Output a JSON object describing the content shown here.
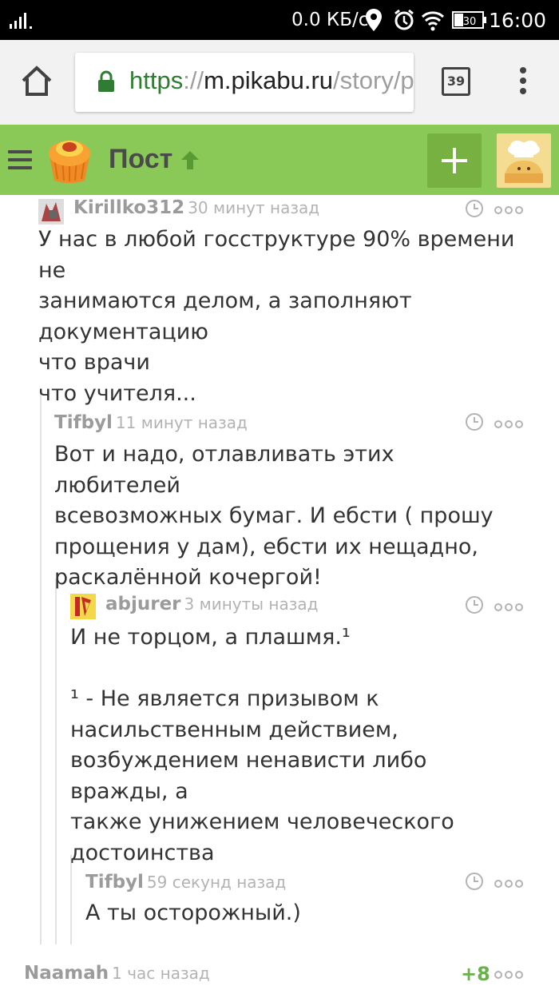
{
  "status_bar": {
    "net_speed": "0.0 КБ/с",
    "battery": "30",
    "time": "16:00"
  },
  "browser": {
    "url_scheme": "https",
    "url_sep": "://",
    "url_host": "m.pikabu.ru",
    "url_path": "/story/p",
    "tab_count": "39"
  },
  "header": {
    "title": "Пост"
  },
  "comments": [
    {
      "author": "Kirillko312",
      "time": "30 минут назад",
      "text": "У нас в любой госструктуре 90% времени не\nзанимаются делом, а заполняют\nдокументацию\nчто врачи\nчто учителя..."
    },
    {
      "author": "Tifbyl",
      "time": "11 минут назад",
      "text": "Вот и надо, отлавливать этих любителей\nвсевозможных бумаг. И ебсти ( прошу\nпрощения у дам), ебсти их нещадно,\nраскалённой кочергой!"
    },
    {
      "author": "abjurer",
      "time": "3 минуты назад",
      "text": "И не торцом, а плашмя.¹\n\n¹ - Не является призывом к\nнасильственным действием,\nвозбуждением ненависти либо вражды, а\nтакже унижением человеческого\nдостоинства"
    },
    {
      "author": "Tifbyl",
      "time": "59 секунд назад",
      "text": "А ты осторожный.)"
    },
    {
      "author": "Naamah",
      "time": "1 час назад",
      "score": "+8"
    }
  ],
  "colors": {
    "header_green": "#8ac858",
    "add_button": "#76b142",
    "score_green": "#6ab04c",
    "lock_green": "#2e7d32"
  },
  "icons": [
    "signal-icon",
    "location-icon",
    "alarm-icon",
    "wifi-icon",
    "battery-icon",
    "home-icon",
    "lock-icon",
    "overflow-menu-icon",
    "hamburger-icon",
    "pikabu-logo",
    "up-arrow-icon",
    "plus-icon",
    "clock-icon",
    "more-dots-icon"
  ]
}
